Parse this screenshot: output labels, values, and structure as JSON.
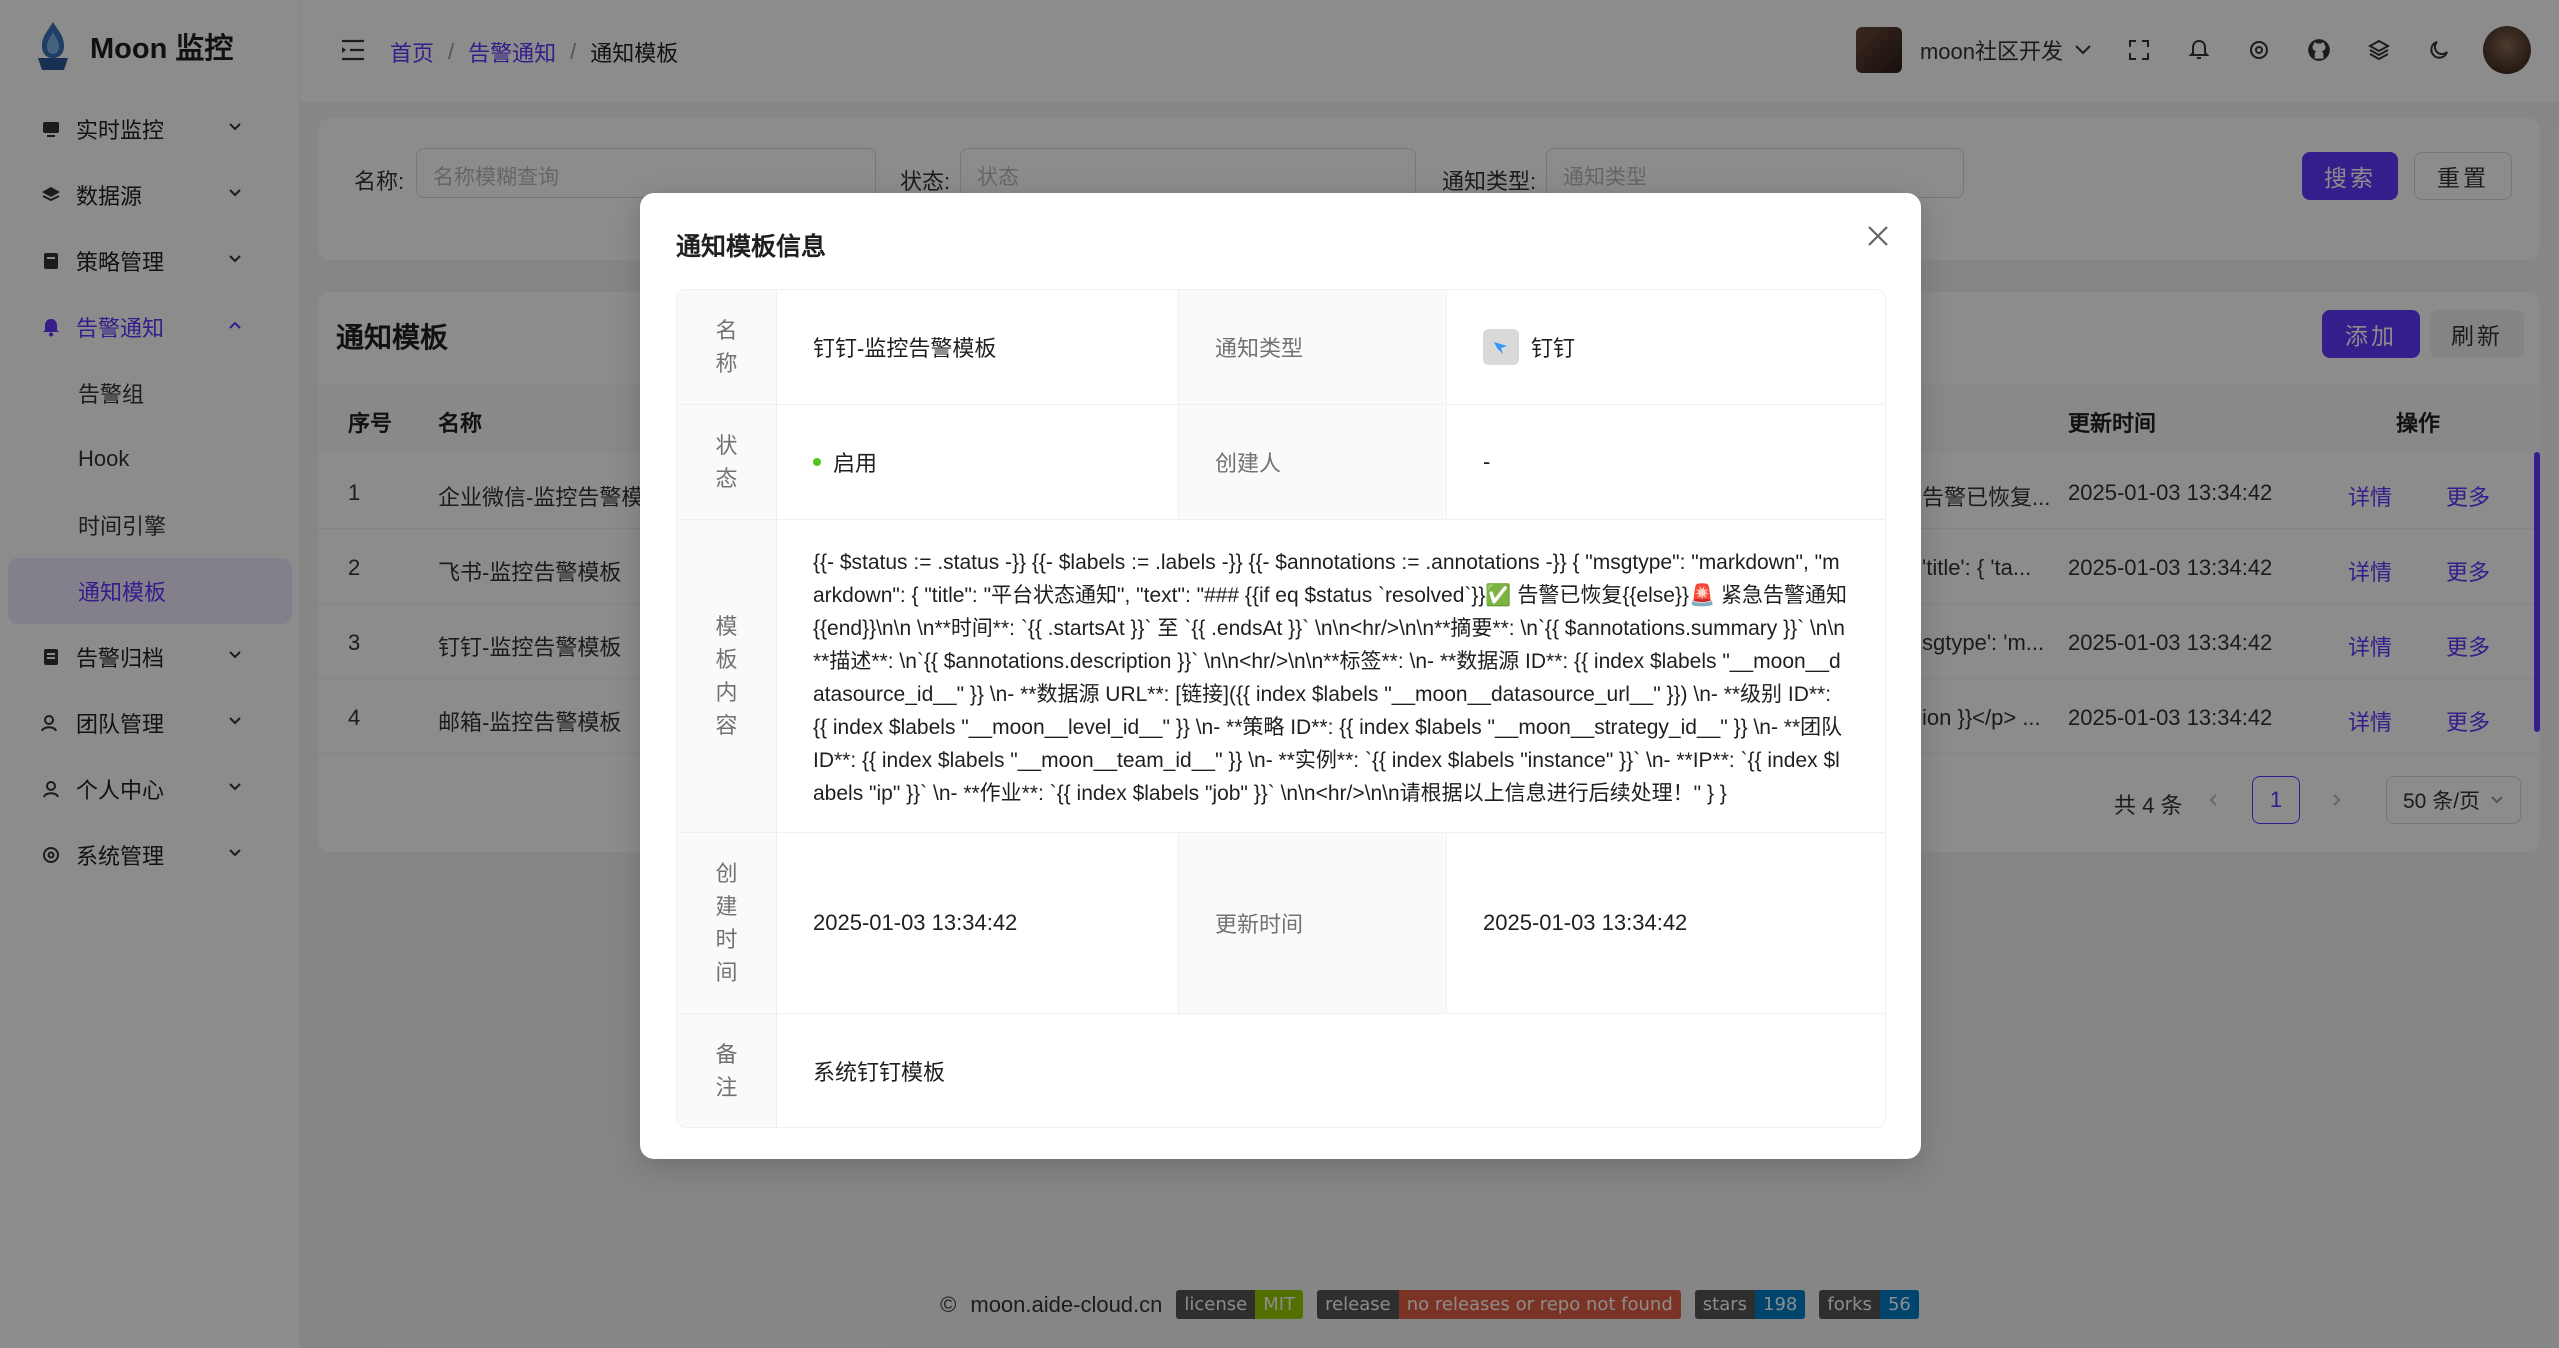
{
  "app": {
    "title": "Moon 监控"
  },
  "sidebar": {
    "items": [
      {
        "label": "实时监控",
        "icon": "monitor-icon"
      },
      {
        "label": "数据源",
        "icon": "layers-icon"
      },
      {
        "label": "策略管理",
        "icon": "strategy-icon"
      },
      {
        "label": "告警通知",
        "icon": "bell-icon",
        "active": true
      },
      {
        "label": "告警归档",
        "icon": "archive-icon"
      },
      {
        "label": "团队管理",
        "icon": "team-icon"
      },
      {
        "label": "个人中心",
        "icon": "user-icon"
      },
      {
        "label": "系统管理",
        "icon": "settings-icon"
      }
    ],
    "sub_items": [
      {
        "label": "告警组"
      },
      {
        "label": "Hook"
      },
      {
        "label": "时间引擎"
      },
      {
        "label": "通知模板",
        "selected": true
      }
    ]
  },
  "header": {
    "breadcrumb": [
      "首页",
      "告警通知",
      "通知模板"
    ],
    "breadcrumb_sep": "/",
    "team_name": "moon社区开发"
  },
  "filter": {
    "name_label": "名称:",
    "name_placeholder": "名称模糊查询",
    "status_label": "状态:",
    "status_placeholder": "状态",
    "type_label": "通知类型:",
    "type_placeholder": "通知类型",
    "search_label": "搜索",
    "reset_label": "重置"
  },
  "table": {
    "title": "通知模板",
    "add_label": "添加",
    "refresh_label": "刷新",
    "columns": {
      "index": "序号",
      "name": "名称",
      "updated": "更新时间",
      "actions": "操作"
    },
    "rows": [
      {
        "index": "1",
        "name": "企业微信-监控告警模板",
        "content_tail": "告警已恢复...",
        "updated": "2025-01-03 13:34:42",
        "detail": "详情",
        "more": "更多"
      },
      {
        "index": "2",
        "name": "飞书-监控告警模板",
        "content_tail": "'title': { 'ta...",
        "updated": "2025-01-03 13:34:42",
        "detail": "详情",
        "more": "更多"
      },
      {
        "index": "3",
        "name": "钉钉-监控告警模板",
        "content_tail": "sgtype': 'm...",
        "updated": "2025-01-03 13:34:42",
        "detail": "详情",
        "more": "更多"
      },
      {
        "index": "4",
        "name": "邮箱-监控告警模板",
        "content_tail": "ion }}</p> ...",
        "updated": "2025-01-03 13:34:42",
        "detail": "详情",
        "more": "更多"
      }
    ],
    "total": "共 4 条",
    "page": "1",
    "page_size": "50 条/页"
  },
  "footer": {
    "site": "moon.aide-cloud.cn",
    "badges": [
      {
        "key": "license",
        "value": "MIT",
        "color": "#97ca00"
      },
      {
        "key": "release",
        "value": "no releases or repo not found",
        "color": "#e05d44"
      },
      {
        "key": "stars",
        "value": "198",
        "color": "#007ec6"
      },
      {
        "key": "forks",
        "value": "56",
        "color": "#007ec6"
      }
    ]
  },
  "modal": {
    "title": "通知模板信息",
    "name_label": "名称",
    "name_value": "钉钉-监控告警模板",
    "type_label": "通知类型",
    "type_value": "钉钉",
    "status_label": "状态",
    "status_value": "启用",
    "creator_label": "创建人",
    "creator_value": "-",
    "content_label": "模板内容",
    "content_value": "{{- $status := .status -}} {{- $labels := .labels -}} {{- $annotations := .annotations -}} { \"msgtype\": \"markdown\", \"markdown\": { \"title\": \"平台状态通知\", \"text\": \"### {{if eq $status `resolved`}}✅ 告警已恢复{{else}}🚨 紧急告警通知{{end}}\\n\\n \\n**时间**: `{{ .startsAt }}` 至 `{{ .endsAt }}` \\n\\n<hr/>\\n\\n**摘要**: \\n`{{ $annotations.summary }}` \\n\\n**描述**: \\n`{{ $annotations.description }}` \\n\\n<hr/>\\n\\n**标签**: \\n- **数据源 ID**: {{ index $labels \"__moon__datasource_id__\" }} \\n- **数据源 URL**: [链接]({{ index $labels \"__moon__datasource_url__\" }}) \\n- **级别 ID**: {{ index $labels \"__moon__level_id__\" }} \\n- **策略 ID**: {{ index $labels \"__moon__strategy_id__\" }} \\n- **团队 ID**: {{ index $labels \"__moon__team_id__\" }} \\n- **实例**: `{{ index $labels \"instance\" }}` \\n- **IP**: `{{ index $labels \"ip\" }}` \\n- **作业**: `{{ index $labels \"job\" }}` \\n\\n<hr/>\\n\\n请根据以上信息进行后续处理！\" } }",
    "created_label": "创建时间",
    "created_value": "2025-01-03 13:34:42",
    "updated_label": "更新时间",
    "updated_value": "2025-01-03 13:34:42",
    "remark_label": "备注",
    "remark_value": "系统钉钉模板"
  },
  "colors": {
    "primary": "#6236ff",
    "status_on": "#52c41a"
  }
}
